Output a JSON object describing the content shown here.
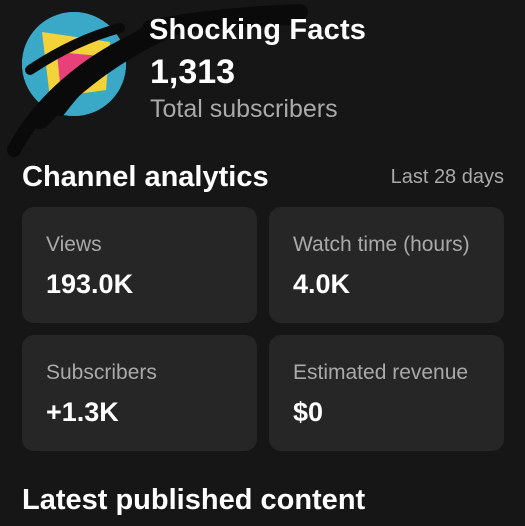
{
  "header": {
    "channel_name": "Shocking Facts",
    "subscriber_count": "1,313",
    "subscriber_label": "Total subscribers",
    "avatar_icon": "channel-avatar-icon"
  },
  "analytics": {
    "title": "Channel analytics",
    "period": "Last 28 days",
    "cards": [
      {
        "label": "Views",
        "value": "193.0K"
      },
      {
        "label": "Watch time (hours)",
        "value": "4.0K"
      },
      {
        "label": "Subscribers",
        "value": "+1.3K"
      },
      {
        "label": "Estimated revenue",
        "value": "$0"
      }
    ]
  },
  "latest": {
    "title": "Latest published content"
  },
  "colors": {
    "background": "#161616",
    "card": "#262626",
    "secondary_text": "#a9a9a9",
    "avatar_bg": "#3aa9c8"
  }
}
